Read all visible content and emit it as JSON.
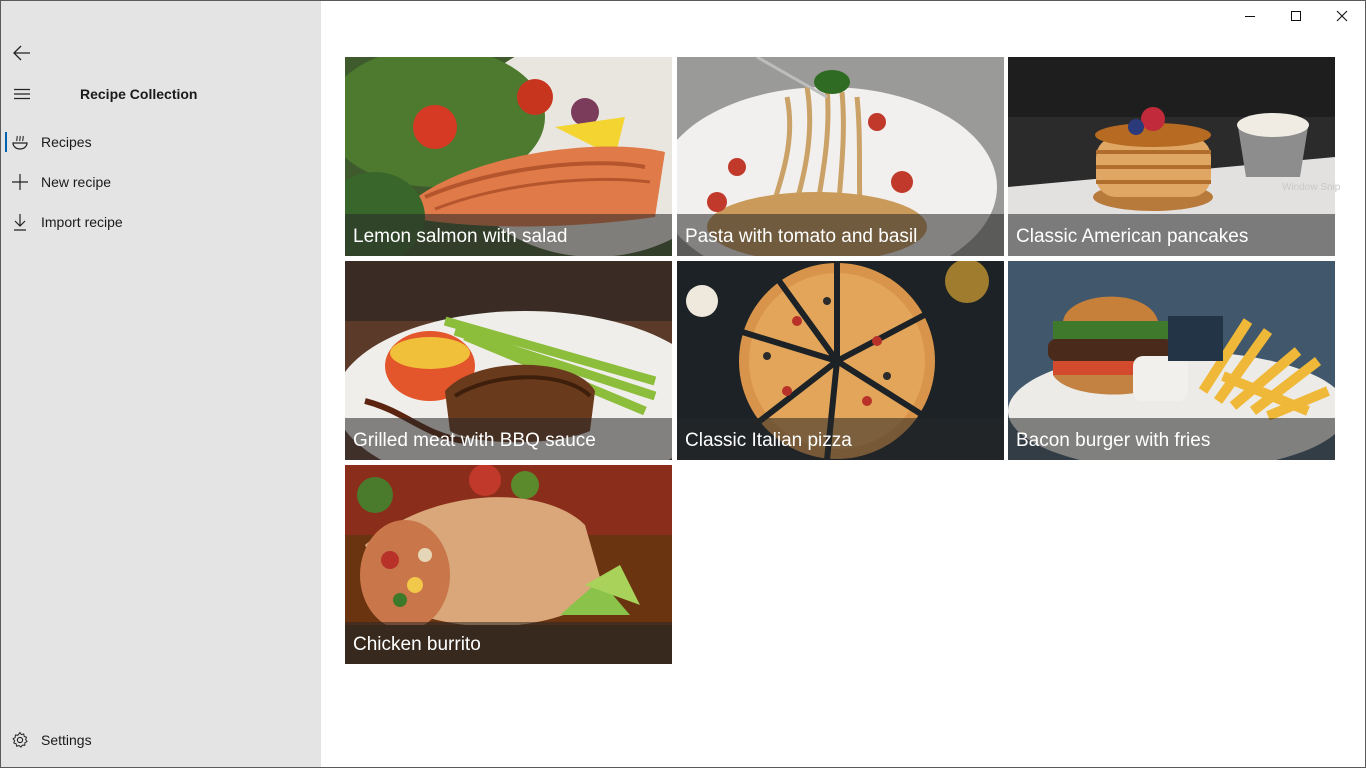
{
  "app": {
    "title": "Recipe Collection"
  },
  "nav": {
    "back_icon": "arrow-left-icon",
    "menu_icon": "hamburger-icon",
    "items": [
      {
        "label": "Recipes",
        "icon": "bowl-icon",
        "selected": true
      },
      {
        "label": "New recipe",
        "icon": "plus-icon",
        "selected": false
      },
      {
        "label": "Import recipe",
        "icon": "download-icon",
        "selected": false
      }
    ],
    "settings": {
      "label": "Settings",
      "icon": "gear-icon"
    }
  },
  "window": {
    "minimize_icon": "minimize-icon",
    "maximize_icon": "maximize-icon",
    "close_icon": "close-icon",
    "snip_hint": "Window Snip"
  },
  "recipes": [
    {
      "title": "Lemon salmon with salad"
    },
    {
      "title": "Pasta with tomato and basil"
    },
    {
      "title": "Classic American pancakes"
    },
    {
      "title": "Grilled meat with BBQ sauce"
    },
    {
      "title": "Classic Italian pizza"
    },
    {
      "title": "Bacon burger with fries"
    },
    {
      "title": "Chicken burrito"
    }
  ],
  "colors": {
    "sidebar_bg": "#e4e4e4",
    "accent": "#0063b1",
    "caption_overlay": "rgba(40,40,40,0.55)"
  }
}
